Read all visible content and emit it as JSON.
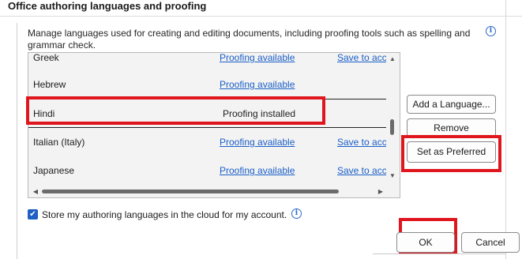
{
  "section": {
    "title": "Office authoring languages and proofing",
    "description": "Manage languages used for creating and editing documents, including proofing tools such as spelling and grammar check."
  },
  "languages": [
    {
      "name": "Greek",
      "status": "Proofing available",
      "save": "Save to acco"
    },
    {
      "name": "Hebrew",
      "status": "Proofing available",
      "save": ""
    },
    {
      "name": "Hindi",
      "status": "Proofing installed",
      "save": ""
    },
    {
      "name": "Italian (Italy)",
      "status": "Proofing available",
      "save": "Save to acco"
    },
    {
      "name": "Japanese",
      "status": "Proofing available",
      "save": "Save to acco"
    }
  ],
  "buttons": {
    "add_language": "Add a Language...",
    "remove": "Remove",
    "set_preferred": "Set as Preferred",
    "ok": "OK",
    "cancel": "Cancel"
  },
  "checkbox": {
    "label": "Store my authoring languages in the cloud for my account.",
    "checked": true
  },
  "icons": {
    "info": "i",
    "scroll_up": "▲",
    "scroll_down": "▼",
    "scroll_left": "◀",
    "scroll_right": "▶",
    "check": "✔"
  },
  "colors": {
    "link": "#1b5fc7",
    "accent": "#1f5fc4",
    "highlight": "#e0161f"
  }
}
